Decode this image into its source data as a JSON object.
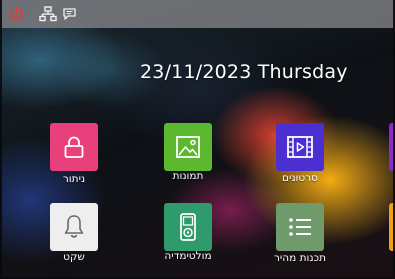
{
  "status_bar": {
    "icons": [
      "power-icon",
      "network-icon",
      "message-icon"
    ],
    "colors": {
      "power": "#e53935",
      "icon": "#f2f2f2",
      "bar": "#808084"
    }
  },
  "header": {
    "datetime": "23/11/2023 Thursday"
  },
  "apps": [
    {
      "label": "ניתור",
      "icon": "lock-icon",
      "color": "#e8407a"
    },
    {
      "label": "תמונות",
      "icon": "image-icon",
      "color": "#5cb82e"
    },
    {
      "label": "סרטונים",
      "icon": "video-icon",
      "color": "#4b2fd1"
    },
    {
      "label": "שקט",
      "icon": "bell-icon",
      "color": "#eeeeee"
    },
    {
      "label": "מולטימדיה",
      "icon": "media-player-icon",
      "color": "#2f9a6b"
    },
    {
      "label": "תכנות מהיר",
      "icon": "list-icon",
      "color": "#6e9a6c"
    }
  ],
  "partial_tiles": [
    {
      "icon": "partial-app-icon",
      "color": "#8a2bc8"
    },
    {
      "icon": "partial-app-icon",
      "color": "#f0a020"
    }
  ]
}
